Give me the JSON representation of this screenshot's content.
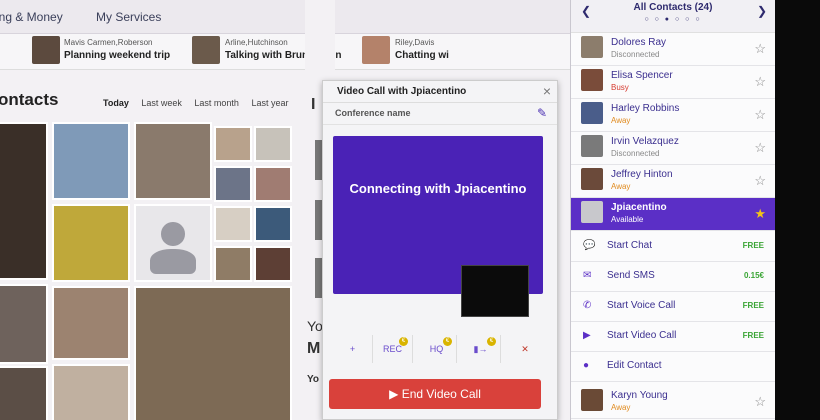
{
  "topnav": {
    "item_partial": "ing & Money",
    "services": "My Services"
  },
  "ticker": [
    {
      "names": "Mavis Carmen,Roberson",
      "message": "Planning weekend trip",
      "color": "#5c4a3e"
    },
    {
      "names": "Arline,Hutchinson",
      "message": "Talking with Bruno,Stein",
      "color": "#6b5a4b"
    },
    {
      "names": "Riley,Davis",
      "message": "Chatting wi",
      "color": "#b4826a"
    }
  ],
  "contacts": {
    "title": "ontacts",
    "filters": [
      "Today",
      "Last week",
      "Last month",
      "Last year"
    ]
  },
  "mid_letters": {
    "i": "I",
    "y": "Yo",
    "m": "M",
    "yo2": "Yo"
  },
  "call": {
    "title": "Video Call with Jpiacentino",
    "conference_label": "Conference name",
    "status": "Connecting with Jpiacentino",
    "controls": [
      "+",
      "REC",
      "HQ",
      "▮→",
      "✕"
    ],
    "end_label": "End Video Call"
  },
  "sidebar": {
    "title": "All Contacts (24)",
    "dots": "○ ○ ● ○ ○ ○",
    "contacts": [
      {
        "name": "Dolores Ray",
        "status": "Disconnected",
        "status_class": "disc",
        "color": "#8c7d6c"
      },
      {
        "name": "Elisa Spencer",
        "status": "Busy",
        "status_class": "busy",
        "color": "#7a4c3a"
      },
      {
        "name": "Harley Robbins",
        "status": "Away",
        "status_class": "away",
        "color": "#4a5d8a"
      },
      {
        "name": "Irvin Velazquez",
        "status": "Disconnected",
        "status_class": "disc",
        "color": "#7a7a7a"
      },
      {
        "name": "Jeffrey Hinton",
        "status": "Away",
        "status_class": "away",
        "color": "#6b4a3a"
      },
      {
        "name": "Jpiacentino",
        "status": "Available",
        "status_class": "avail",
        "color": "#c8c8cc"
      }
    ],
    "actions": [
      {
        "icon": "💬",
        "label": "Start Chat",
        "price": "FREE"
      },
      {
        "icon": "✉",
        "label": "Send SMS",
        "price": "0.15€"
      },
      {
        "icon": "✆",
        "label": "Start Voice Call",
        "price": "FREE"
      },
      {
        "icon": "▶",
        "label": "Start Video Call",
        "price": "FREE"
      },
      {
        "icon": "●",
        "label": "Edit Contact",
        "price": ""
      }
    ],
    "last_contact": {
      "name": "Karyn Young",
      "status": "Away",
      "color": "#6a4a36"
    }
  }
}
